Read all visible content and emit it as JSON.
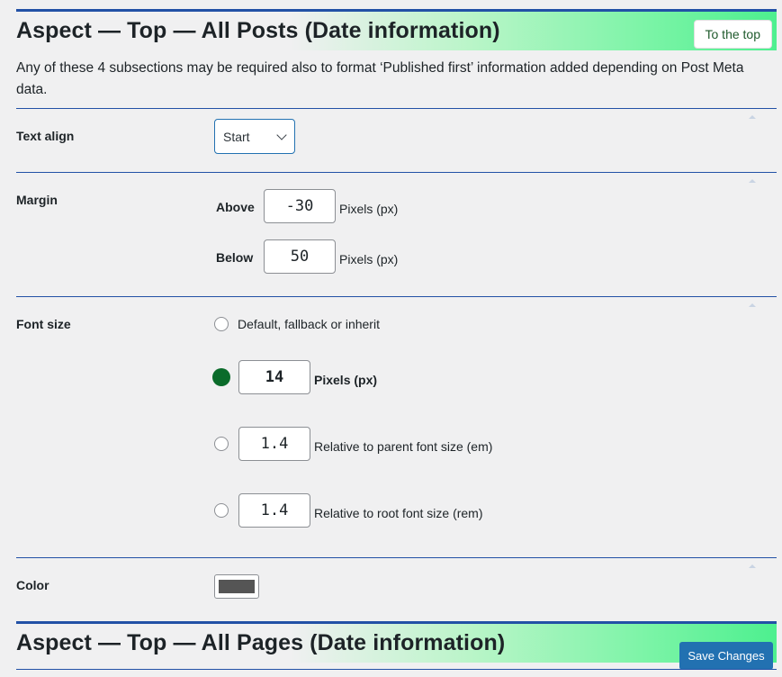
{
  "section1": {
    "title": "Aspect — Top — All Posts (Date information)",
    "to_top_label": "To the top",
    "description": "Any of these 4 subsections may be required also to format ‘Published first’ information added depending on Post Meta data."
  },
  "text_align": {
    "label": "Text align",
    "selected": "Start"
  },
  "margin": {
    "label": "Margin",
    "above_label": "Above",
    "above_value": "-30",
    "above_unit": "Pixels (px)",
    "below_label": "Below",
    "below_value": "50",
    "below_unit": "Pixels (px)"
  },
  "font_size": {
    "label": "Font size",
    "options": [
      {
        "label": "Default, fallback or inherit",
        "checked": false
      },
      {
        "value": "14",
        "unit": "Pixels (px)",
        "checked": true
      },
      {
        "value": "1.4",
        "unit": "Relative to parent font size (em)",
        "checked": false
      },
      {
        "value": "1.4",
        "unit": "Relative to root font size (rem)",
        "checked": false
      }
    ]
  },
  "color": {
    "label": "Color",
    "value": "#555555"
  },
  "section2": {
    "title": "Aspect — Top — All Pages (Date information)"
  },
  "save_label": "Save Changes",
  "colors": {
    "accent_blue": "#2251a6",
    "button_blue": "#2271b1",
    "radio_checked": "#0a6b2a",
    "gradient_end": "#4df08f"
  }
}
